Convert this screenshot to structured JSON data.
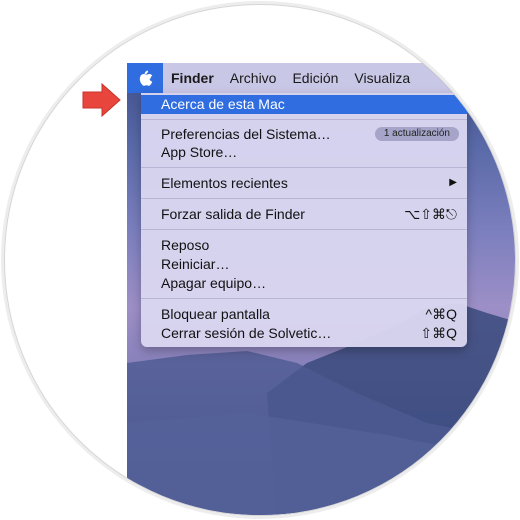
{
  "menubar": {
    "app_name": "Finder",
    "items": [
      "Archivo",
      "Edición",
      "Visualiza"
    ]
  },
  "apple_menu": {
    "items": [
      {
        "label": "Acerca de esta Mac",
        "selected": true
      },
      {
        "label": "Preferencias del Sistema…",
        "badge": "1 actualización"
      },
      {
        "label": "App Store…"
      },
      {
        "label": "Elementos recientes",
        "submenu_arrow": "▶"
      },
      {
        "label": "Forzar salida de Finder",
        "shortcut": "⌥⇧⌘⎋"
      },
      {
        "label": "Reposo"
      },
      {
        "label": "Reiniciar…"
      },
      {
        "label": "Apagar equipo…"
      },
      {
        "label": "Bloquear pantalla",
        "shortcut": "^⌘Q"
      },
      {
        "label": "Cerrar sesión de Solvetic…",
        "shortcut": "⇧⌘Q"
      }
    ]
  },
  "colors": {
    "accent": "#2f6de0",
    "arrow": "#e8453c"
  }
}
